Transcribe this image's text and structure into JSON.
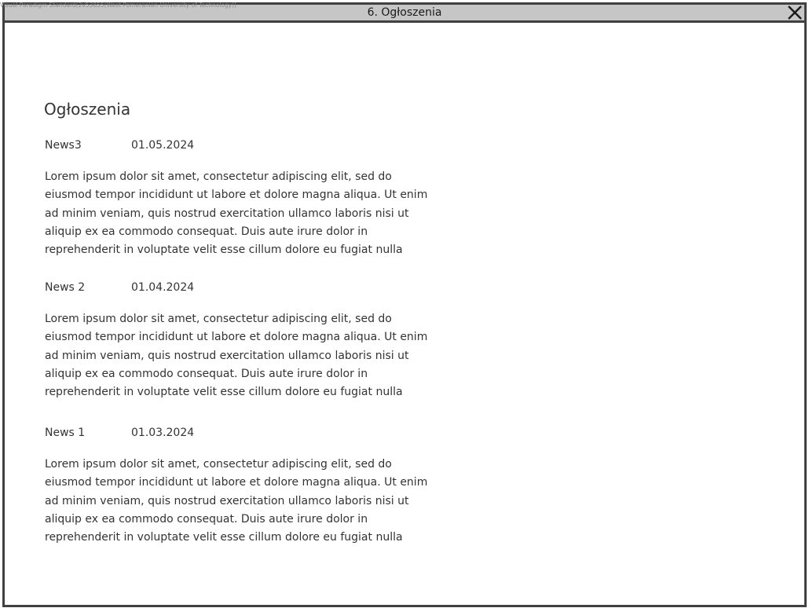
{
  "watermark": "Visual Paradigm Standard(2v53855(West Pomeranian University of Technology))",
  "window": {
    "title": "6. Ogłoszenia"
  },
  "page": {
    "title": "Ogłoszenia"
  },
  "news": [
    {
      "title": "News3",
      "date": "01.05.2024",
      "body_lines": [
        "Lorem ipsum dolor sit amet, consectetur adipiscing elit, sed do",
        "eiusmod tempor incididunt ut labore et dolore magna aliqua. Ut enim",
        "ad minim veniam, quis nostrud exercitation ullamco laboris nisi ut",
        "aliquip ex ea commodo consequat. Duis aute irure dolor in",
        "reprehenderit in voluptate velit esse cillum dolore eu fugiat nulla"
      ]
    },
    {
      "title": "News 2",
      "date": "01.04.2024",
      "body_lines": [
        "Lorem ipsum dolor sit amet, consectetur adipiscing elit, sed do",
        "eiusmod tempor incididunt ut labore et dolore magna aliqua. Ut enim",
        "ad minim veniam, quis nostrud exercitation ullamco laboris nisi ut",
        "aliquip ex ea commodo consequat. Duis aute irure dolor in",
        "reprehenderit in voluptate velit esse cillum dolore eu fugiat nulla"
      ]
    },
    {
      "title": "News 1",
      "date": "01.03.2024",
      "body_lines": [
        "Lorem ipsum dolor sit amet, consectetur adipiscing elit, sed do",
        "eiusmod tempor incididunt ut labore et dolore magna aliqua. Ut enim",
        "ad minim veniam, quis nostrud exercitation ullamco laboris nisi ut",
        "aliquip ex ea commodo consequat. Duis aute irure dolor in",
        "reprehenderit in voluptate velit esse cillum dolore eu fugiat nulla"
      ]
    }
  ],
  "icons": {
    "close": "close-icon"
  },
  "colors": {
    "frame": "#404040",
    "title_bar": "#c6c6c6",
    "text": "#333333"
  }
}
